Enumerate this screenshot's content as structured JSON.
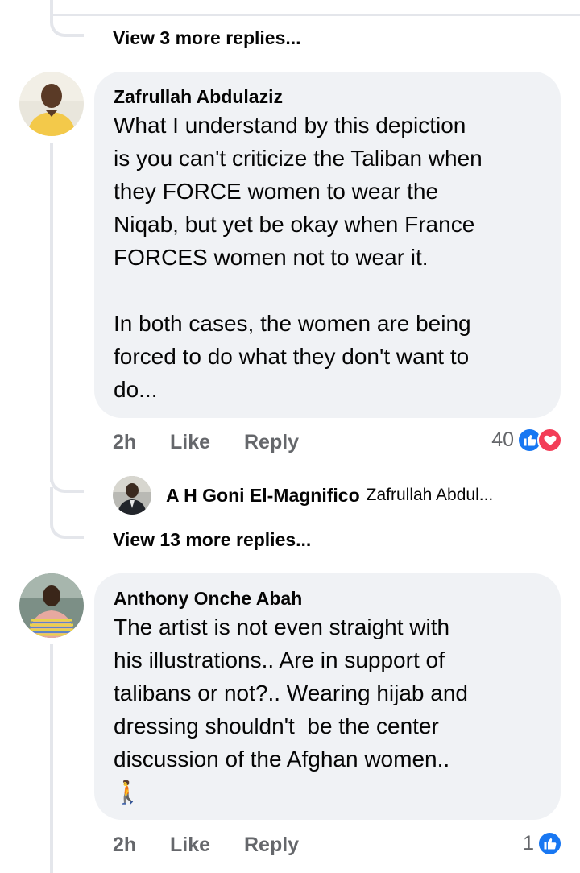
{
  "thread_top": {
    "view_more_label": "View 3 more replies..."
  },
  "comments": [
    {
      "author": "Zafrullah Abdulaziz",
      "text": "What I understand by this depiction\nis you can't criticize the Taliban when\nthey FORCE women to wear the\nNiqab, but yet be okay when France\nFORCES women not to wear it.\n\nIn both cases, the women are being\nforced to do what they don't want to\ndo...",
      "time": "2h",
      "like_label": "Like",
      "reply_label": "Reply",
      "reaction_count": "40",
      "reactions": [
        "like-icon",
        "love-icon"
      ],
      "replies_preview": {
        "author": "A H Goni El-Magnifico",
        "snippet": "Zafrullah Abdul..."
      },
      "view_more_label": "View 13 more replies..."
    },
    {
      "author": "Anthony Onche Abah",
      "text": "The artist is not even straight with\nhis illustrations.. Are in support of\ntalibans or not?.. Wearing hijab and\ndressing shouldn't  be the center\ndiscussion of the Afghan women..",
      "emoji": "🚶",
      "time": "2h",
      "like_label": "Like",
      "reply_label": "Reply",
      "reaction_count": "1",
      "reactions": [
        "like-icon"
      ]
    }
  ],
  "colors": {
    "bubble": "#f0f2f5",
    "thread_line": "#e4e6eb",
    "meta_text": "#65676b",
    "like_blue": "#1877f2",
    "love_red": "#f33e58"
  }
}
